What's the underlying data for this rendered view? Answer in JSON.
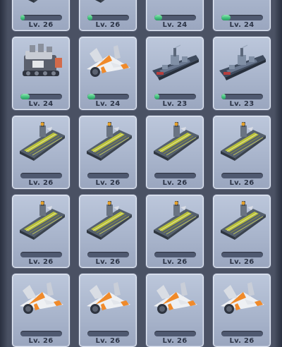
{
  "screen": "unit-collection-grid",
  "colors": {
    "card_bg": "#aab6cd",
    "bar_track": "#4f5970",
    "bar_fill": "#3fbe7b",
    "text": "#2c3446"
  },
  "rows": [
    [
      {
        "unit": "carrier",
        "level": "Lv. 26",
        "progress": 0.1
      },
      {
        "unit": "carrier",
        "level": "Lv. 26",
        "progress": 0.12
      },
      {
        "unit": "mech-tank",
        "level": "Lv. 24",
        "progress": 0.18
      },
      {
        "unit": "mech-tank",
        "level": "Lv. 24",
        "progress": 0.22
      }
    ],
    [
      {
        "unit": "mech-tank",
        "level": "Lv. 24",
        "progress": 0.22
      },
      {
        "unit": "jet-fighter",
        "level": "Lv. 24",
        "progress": 0.18
      },
      {
        "unit": "destroyer",
        "level": "Lv. 23",
        "progress": 0.12
      },
      {
        "unit": "destroyer",
        "level": "Lv. 23",
        "progress": 0.1
      }
    ],
    [
      {
        "unit": "carrier",
        "level": "Lv. 26",
        "progress": 0
      },
      {
        "unit": "carrier",
        "level": "Lv. 26",
        "progress": 0
      },
      {
        "unit": "carrier",
        "level": "Lv. 26",
        "progress": 0
      },
      {
        "unit": "carrier",
        "level": "Lv. 26",
        "progress": 0
      }
    ],
    [
      {
        "unit": "carrier",
        "level": "Lv. 26",
        "progress": 0
      },
      {
        "unit": "carrier",
        "level": "Lv. 26",
        "progress": 0
      },
      {
        "unit": "carrier",
        "level": "Lv. 26",
        "progress": 0
      },
      {
        "unit": "carrier",
        "level": "Lv. 26",
        "progress": 0
      }
    ],
    [
      {
        "unit": "jet-fighter",
        "level": "Lv. 26",
        "progress": 0
      },
      {
        "unit": "jet-fighter",
        "level": "Lv. 26",
        "progress": 0
      },
      {
        "unit": "jet-fighter",
        "level": "Lv. 26",
        "progress": 0
      },
      {
        "unit": "jet-fighter",
        "level": "Lv. 26",
        "progress": 0
      }
    ]
  ]
}
